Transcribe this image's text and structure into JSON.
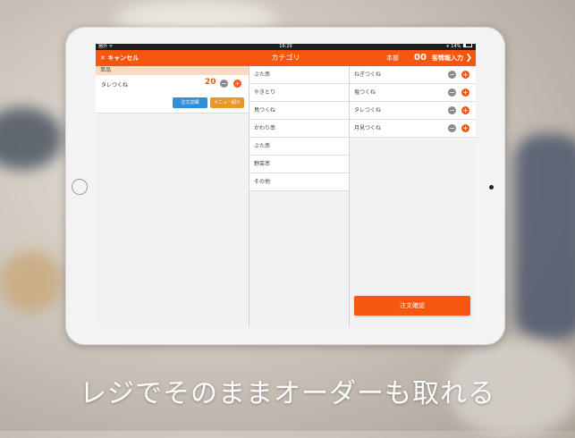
{
  "status_bar": {
    "carrier": "圏外 ᯤ",
    "time": "16:29",
    "battery": "∗ 14%"
  },
  "nav": {
    "cancel_label": "キャンセル",
    "title": "カテゴリ",
    "store_label": "本部",
    "order_number": "00",
    "guest_info_label": "客情報入力"
  },
  "order": {
    "section_label": "単品",
    "item_name": "タレつくね",
    "quantity": "20",
    "detail_button": "注文詳細",
    "menu_detail_button": "メニュー紹介"
  },
  "categories": [
    {
      "label": "ぶた串"
    },
    {
      "label": "やきとり"
    },
    {
      "label": "鳥つくね"
    },
    {
      "label": "かわり串"
    },
    {
      "label": "ぶた串"
    },
    {
      "label": "野菜串"
    },
    {
      "label": "その他"
    }
  ],
  "menu_items": [
    {
      "label": "ねぎつくね"
    },
    {
      "label": "塩つくね"
    },
    {
      "label": "タレつくね"
    },
    {
      "label": "月見つくね"
    }
  ],
  "confirm_button": "注文確認",
  "caption": "レジでそのままオーダーも取れる",
  "colors": {
    "accent": "#f6560f",
    "section": "#fbd9c3",
    "detail_button": "#2f8fd8",
    "menu_button": "#e9972b"
  },
  "icons": {
    "cancel": "close-icon",
    "guest": "chevron-right-icon",
    "minus": "minus-circle-icon",
    "plus": "plus-circle-icon"
  }
}
